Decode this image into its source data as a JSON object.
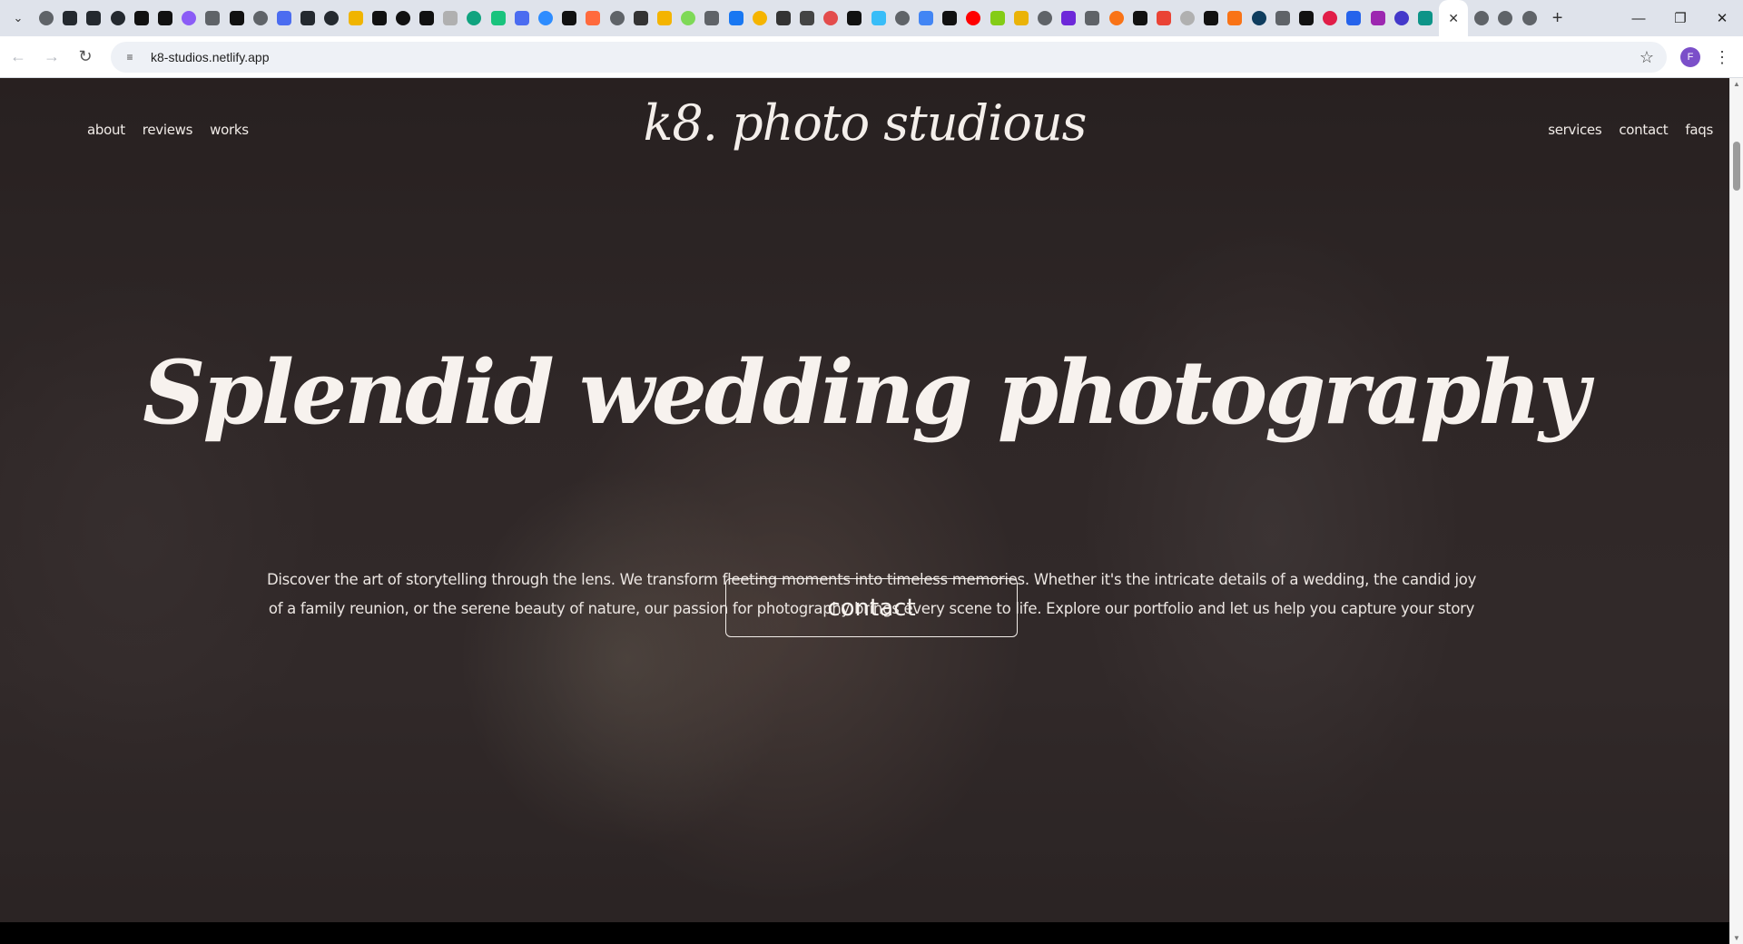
{
  "browser": {
    "url": "k8-studios.netlify.app",
    "profile_initial": "F",
    "pinned_tab_colors": [
      "#5f6368",
      "#24292f",
      "#24292f",
      "#24292f",
      "#111111",
      "#111111",
      "#8b5cf6",
      "#5f6368",
      "#111111",
      "#5f6368",
      "#4b6cf0",
      "#24292f",
      "#24292f",
      "#f0b400",
      "#111111",
      "#111111",
      "#111111",
      "#b0b0b0",
      "#10a37f",
      "#19c37d",
      "#4b6cf0",
      "#2d8cff",
      "#111111",
      "#ff6a3d",
      "#5f6368",
      "#333333",
      "#f4b400",
      "#7ed957",
      "#5f6368",
      "#1877f2",
      "#f5b400",
      "#333333",
      "#444444",
      "#e34c4c",
      "#111111",
      "#38bdf8",
      "#5f6368",
      "#4285f4",
      "#111111",
      "#ff0000",
      "#84cc16",
      "#eab308",
      "#5f6368",
      "#6d28d9",
      "#5f6368",
      "#f97316",
      "#111111",
      "#ea4335",
      "#b0b0b0",
      "#111111",
      "#f97316",
      "#0f3d5e",
      "#5f6368",
      "#111111",
      "#e11d48",
      "#2563eb",
      "#9c27b0",
      "#4338ca",
      "#0d9488"
    ],
    "trailing_tabs": [
      "#5f6368",
      "#5f6368",
      "#5f6368"
    ],
    "icons": {
      "tab_search": "chevron-down-icon",
      "active_tab_close": "close-icon",
      "new_tab": "plus-icon",
      "back": "arrow-left-icon",
      "forward": "arrow-right-icon",
      "reload": "reload-icon",
      "site_info": "tune-icon",
      "bookmark": "star-icon",
      "menu": "kebab-menu-icon"
    }
  },
  "site": {
    "logo": "k8. photo studious",
    "nav_left": [
      {
        "label": "about"
      },
      {
        "label": "reviews"
      },
      {
        "label": "works"
      }
    ],
    "nav_right": [
      {
        "label": "services"
      },
      {
        "label": "contact"
      },
      {
        "label": "faqs"
      }
    ],
    "hero": {
      "title": "Splendid wedding photography",
      "description": "Discover the art of storytelling through the lens. We transform fleeting moments into timeless memories. Whether it's the intricate details of a wedding, the candid joy of a family reunion, or the serene beauty of nature, our passion for photography brings every scene to life. Explore our portfolio and let us help you capture your story",
      "cta_label": "contact"
    }
  }
}
